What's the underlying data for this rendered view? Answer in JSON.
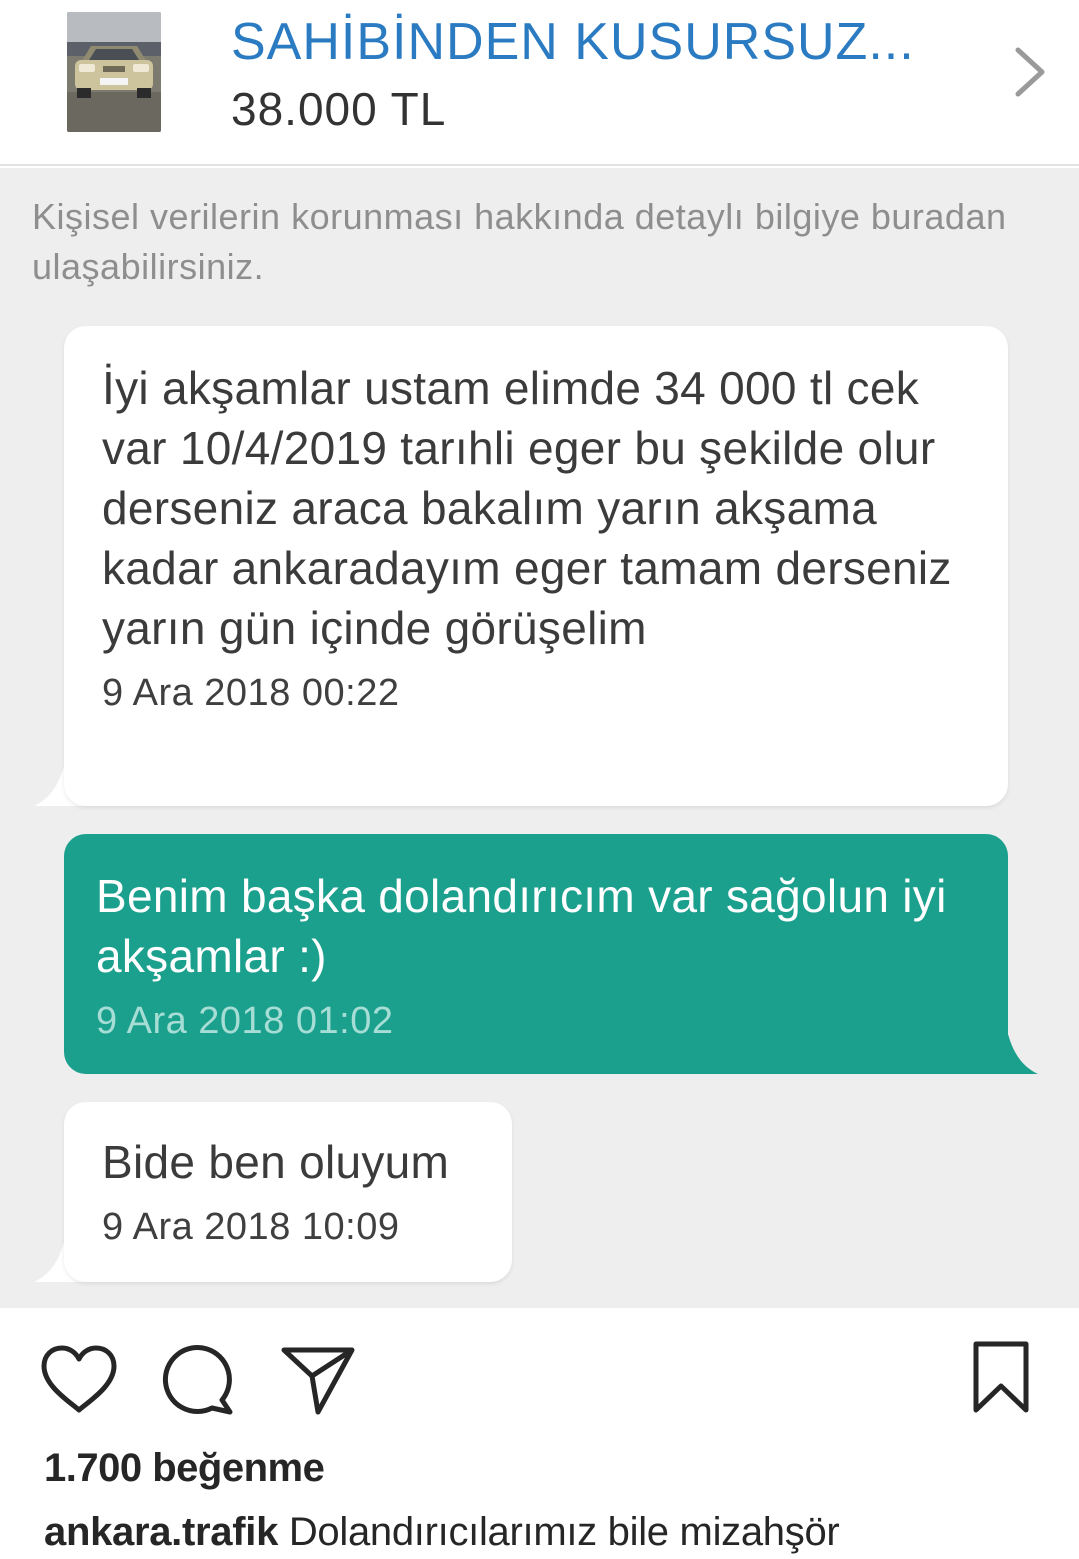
{
  "listing": {
    "title": "SAHİBİNDEN KUSURSUZ...",
    "price": "38.000 TL",
    "thumbnail_icon": "car-photo",
    "chevron_icon": "chevron-right-icon"
  },
  "chat": {
    "privacy_note": "Kişisel verilerin korunması hakkında detaylı bilgiye buradan ulaşabilirsiniz.",
    "messages": [
      {
        "direction": "incoming",
        "text": "İyi akşamlar ustam elimde 34 000 tl cek var 10/4/2019 tarıhli eger bu şekilde olur derseniz araca bakalım yarın akşama kadar ankaradayım eger tamam derseniz yarın gün içinde görüşelim",
        "time": "9 Ara 2018 00:22"
      },
      {
        "direction": "outgoing",
        "text": "Benim başka dolandırıcım var sağolun iyi akşamlar :)",
        "time": "9 Ara 2018 01:02"
      },
      {
        "direction": "incoming",
        "text": "Bide ben oluyum",
        "time": "9 Ara 2018 10:09"
      }
    ]
  },
  "post": {
    "actions": [
      "heart-icon",
      "comment-icon",
      "share-icon",
      "bookmark-icon"
    ],
    "likes": "1.700 beğenme",
    "username": "ankara.trafik",
    "caption": "Dolandırıcılarımız bile mizahşör"
  },
  "colors": {
    "title_blue": "#2a7bc1",
    "outgoing_bubble": "#1ca08e",
    "chat_background": "#eeeeee"
  }
}
